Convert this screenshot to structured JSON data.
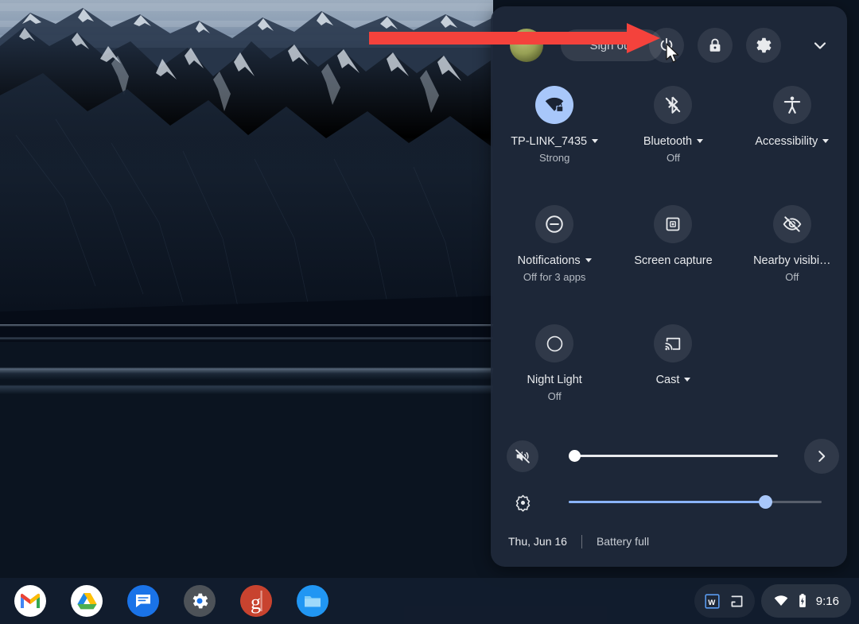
{
  "quick_settings": {
    "header": {
      "avatar": "user-avatar",
      "sign_out_label": "Sign out",
      "power_icon": "power-icon",
      "lock_icon": "lock-icon",
      "settings_icon": "gear-icon",
      "collapse_icon": "chevron-down-icon"
    },
    "tiles": [
      {
        "name": "network",
        "icon": "wifi-locked-icon",
        "label": "TP-LINK_7435",
        "sublabel": "Strong",
        "has_caret": true,
        "active": true
      },
      {
        "name": "bluetooth",
        "icon": "bluetooth-off-icon",
        "label": "Bluetooth",
        "sublabel": "Off",
        "has_caret": true,
        "active": false
      },
      {
        "name": "accessibility",
        "icon": "accessibility-icon",
        "label": "Accessibility",
        "sublabel": "",
        "has_caret": true,
        "active": false
      },
      {
        "name": "notifications",
        "icon": "do-not-disturb-icon",
        "label": "Notifications",
        "sublabel": "Off for 3 apps",
        "has_caret": true,
        "active": false
      },
      {
        "name": "screen-capture",
        "icon": "screen-capture-icon",
        "label": "Screen capture",
        "sublabel": "",
        "has_caret": false,
        "active": false
      },
      {
        "name": "nearby-visibility",
        "icon": "eye-off-icon",
        "label": "Nearby visibi…",
        "sublabel": "Off",
        "has_caret": false,
        "active": false
      },
      {
        "name": "night-light",
        "icon": "moon-icon",
        "label": "Night Light",
        "sublabel": "Off",
        "has_caret": false,
        "active": false
      },
      {
        "name": "cast",
        "icon": "cast-icon",
        "label": "Cast",
        "sublabel": "",
        "has_caret": true,
        "active": false
      }
    ],
    "sliders": {
      "volume": {
        "icon": "volume-muted-icon",
        "value": 0,
        "expand_icon": "chevron-right-icon"
      },
      "brightness": {
        "icon": "brightness-icon",
        "value": 78
      }
    },
    "footer": {
      "date": "Thu, Jun 16",
      "battery": "Battery full"
    },
    "accent_color": "#a8c7fa",
    "panel_color": "#1f293a"
  },
  "annotation": {
    "arrow_color": "#f4423c",
    "points_to": "power-icon"
  },
  "shelf": {
    "apps": [
      {
        "name": "gmail",
        "label": "Gmail"
      },
      {
        "name": "google-drive",
        "label": "Drive"
      },
      {
        "name": "google-chat",
        "label": "Chat"
      },
      {
        "name": "settings",
        "label": "Settings"
      },
      {
        "name": "groovypost",
        "label": "g"
      },
      {
        "name": "files",
        "label": "Files"
      }
    ],
    "tray": {
      "word_icon": "word-document-icon",
      "tote_icon": "tote-icon",
      "wifi_icon": "wifi-icon",
      "battery_icon": "battery-charging-icon",
      "time": "9:16"
    }
  }
}
